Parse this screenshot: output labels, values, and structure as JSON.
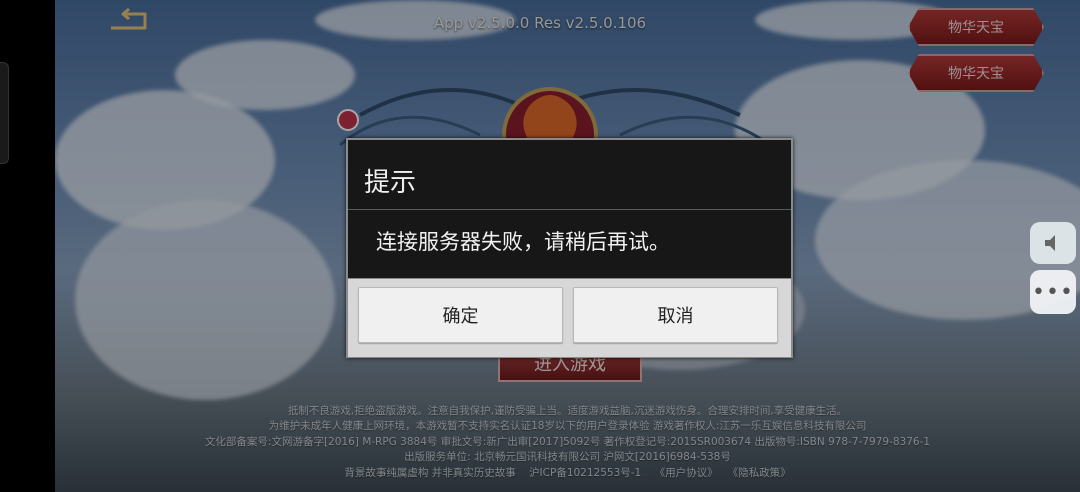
{
  "header": {
    "version": "App v2.5.0.0 Res v2.5.0.106"
  },
  "side_buttons": [
    "物华天宝",
    "物华天宝"
  ],
  "main": {
    "enter_label": "进入游戏"
  },
  "dialog": {
    "title": "提示",
    "message": "连接服务器失败，请稍后再试。",
    "ok_label": "确定",
    "cancel_label": "取消"
  },
  "footer": {
    "lines": [
      "抵制不良游戏,拒绝盗版游戏。注意自我保护,谨防受骗上当。适度游戏益脑,沉迷游戏伤身。合理安排时间,享受健康生活。",
      "为维护未成年人健康上网环境，本游戏暂不支持实名认证18岁以下的用户登录体验 游戏著作权人:江苏一乐互娱信息科技有限公司",
      "文化部备案号:文网游备字[2016] M-RPG 3884号 审批文号:新广出审[2017]5092号 著作权登记号:2015SR003674 出版物号:ISBN 978-7-7979-8376-1",
      "出版服务单位: 北京畅元国讯科技有限公司 沪网文[2016]6984-538号"
    ],
    "last_line_prefix": "背景故事纯属虚构 并非真实历史故事",
    "icp": "沪ICP备10212553号-1",
    "user_agreement": "《用户协议》",
    "privacy_policy": "《隐私政策》"
  },
  "icons": {
    "back": "back-icon",
    "volume": "volume-icon",
    "more": "more-icon"
  },
  "colors": {
    "dialog_bg": "#171717",
    "button_bg": "#f0f0f0",
    "side_button": "#b43a3a"
  }
}
